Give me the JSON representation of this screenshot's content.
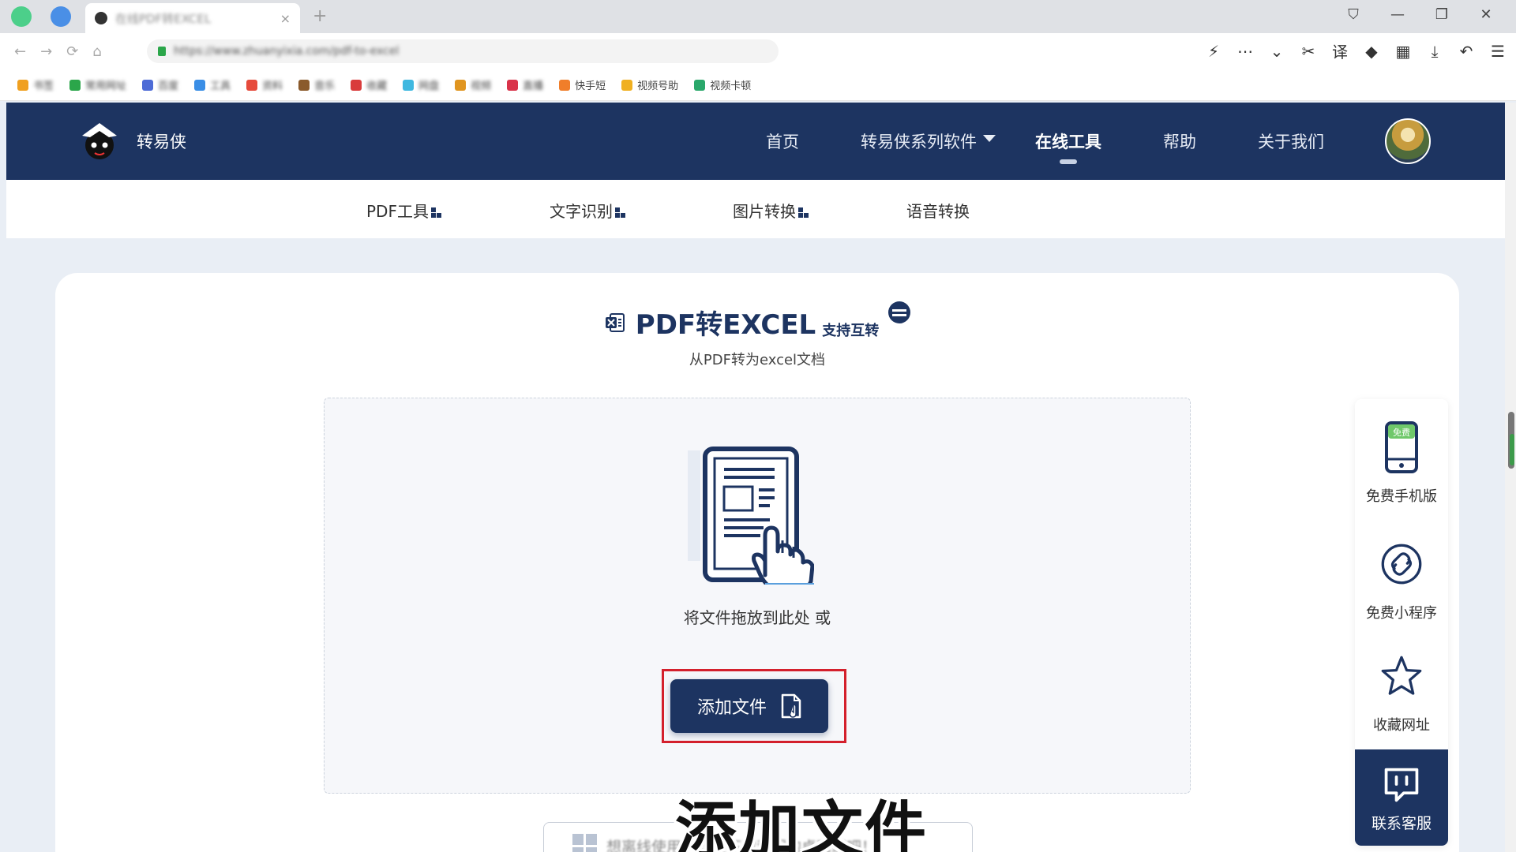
{
  "browser": {
    "tab_title": "在线PDF转EXCEL",
    "tab_close": "×",
    "new_tab": "+",
    "url": "https://www.zhuanyixia.com/pdf-to-excel",
    "controls": {
      "pin": "⛉",
      "minimize": "—",
      "restore": "❐",
      "close": "✕"
    },
    "tools": [
      "⚡",
      "⋯",
      "⌄",
      "✂",
      "译",
      "◆",
      "▦",
      "⤓",
      "↶",
      "☰"
    ],
    "nav": {
      "back": "←",
      "forward": "→",
      "refresh": "⟳",
      "home": "⌂"
    },
    "bookmarks": [
      {
        "label": "书签",
        "color": "#f0a020",
        "blur": true
      },
      {
        "label": "常用网址",
        "color": "#2ba64a",
        "blur": true
      },
      {
        "label": "百度",
        "color": "#4d6bd6",
        "blur": true
      },
      {
        "label": "工具",
        "color": "#3a8ee6",
        "blur": true
      },
      {
        "label": "资料",
        "color": "#e64b3c",
        "blur": true
      },
      {
        "label": "音乐",
        "color": "#8a5a2b",
        "blur": true
      },
      {
        "label": "收藏",
        "color": "#d93b3b",
        "blur": true
      },
      {
        "label": "网盘",
        "color": "#3fb8e0",
        "blur": true
      },
      {
        "label": "视频",
        "color": "#e09520",
        "blur": true
      },
      {
        "label": "直播",
        "color": "#d9334a",
        "blur": true
      },
      {
        "label": "快手短",
        "color": "#f07e2a",
        "blur": false
      },
      {
        "label": "视频号助",
        "color": "#f0b020",
        "blur": false
      },
      {
        "label": "视频卡顿",
        "color": "#2aa86b",
        "blur": false
      }
    ]
  },
  "header": {
    "brand": "转易侠",
    "nav": [
      {
        "label": "首页",
        "active": false
      },
      {
        "label": "转易侠系列软件",
        "active": false,
        "dropdown": true
      },
      {
        "label": "在线工具",
        "active": true
      },
      {
        "label": "帮助",
        "active": false
      },
      {
        "label": "关于我们",
        "active": false
      }
    ]
  },
  "subnav": [
    {
      "label": "PDF工具",
      "icon": true
    },
    {
      "label": "文字识别",
      "icon": true
    },
    {
      "label": "图片转换",
      "icon": true
    },
    {
      "label": "语音转换",
      "icon": false
    }
  ],
  "main": {
    "title": "PDF转EXCEL",
    "title_sub": "支持互转",
    "subtitle": "从PDF转为excel文档",
    "drop_hint": "将文件拖放到此处 或",
    "add_button": "添加文件",
    "banner_text": "想离线使用？欢迎下载我们的桌面端吧！"
  },
  "sidebar": {
    "mobile": "免费手机版",
    "mobile_badge": "免费",
    "miniprogram": "免费小程序",
    "bookmark": "收藏网址",
    "service": "联系客服"
  },
  "caption": "添加文件",
  "colors": {
    "brand_navy": "#1d3461",
    "highlight_red": "#d4202c",
    "page_bg": "#e9eef5"
  }
}
